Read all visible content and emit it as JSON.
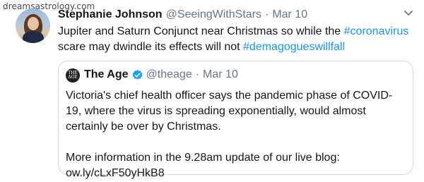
{
  "watermark": "dreamsastrology.com",
  "tweet": {
    "author_name": "Stephanie Johnson",
    "author_handle": "@SeeingWithStars",
    "separator": "·",
    "date": "Mar 10",
    "text_parts": {
      "p1": "Jupiter and Saturn Conjunct near Christmas so while the ",
      "tag1": "#coronavirus",
      "p2": " scare may dwindle its effects will not ",
      "tag2": "#demagogueswillfall"
    },
    "menu_icon": "chevron-down-icon"
  },
  "quoted": {
    "avatar_text_line1": "THE",
    "avatar_text_line2": "AGE",
    "name": "The Age",
    "verified_icon": "verified-badge-icon",
    "handle": "@theage",
    "separator": "·",
    "date": "Mar 10",
    "body_line1": "Victoria's chief health officer says the pandemic phase of COVID-19, where the virus is spreading exponentially, would almost certainly be over by Christmas.",
    "body_line2": "More information in the 9.28am update of our live blog: ow.ly/cLxF50yHkB8"
  },
  "colors": {
    "link": "#1b95e0",
    "muted": "#657786",
    "text": "#14171a",
    "verified": "#1da1f2",
    "border": "#cfd9de"
  }
}
